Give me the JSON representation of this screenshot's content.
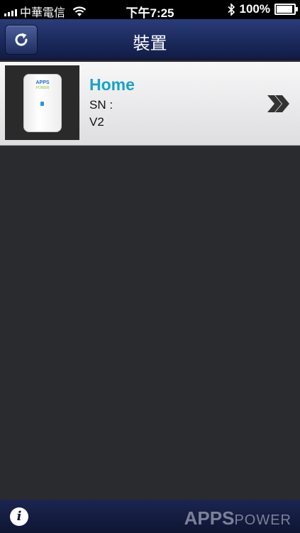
{
  "status_bar": {
    "carrier": "中華電信",
    "time": "下午7:25",
    "battery": "100%",
    "battery_level": 1.0
  },
  "navbar": {
    "title": "裝置",
    "refresh_icon": "refresh-icon"
  },
  "devices": [
    {
      "name": "Home",
      "sn": "SN :",
      "version": "V2",
      "thumb_brand": "APPS",
      "thumb_brand2": "POWER"
    }
  ],
  "footer": {
    "info_icon": "info-icon",
    "logo_apps": "APPS",
    "logo_power": "POWER"
  },
  "colors": {
    "nav": "#1b2a5c",
    "accent": "#19a3c4",
    "background": "#2a2b2f"
  }
}
